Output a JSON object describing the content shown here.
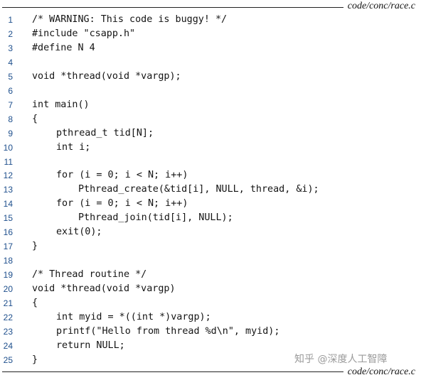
{
  "file": {
    "label_top": "code/conc/race.c",
    "label_bottom": "code/conc/race.c"
  },
  "code_lines": [
    {
      "n": "1",
      "indent": 0,
      "text": "/* WARNING: This code is buggy! */"
    },
    {
      "n": "2",
      "indent": 0,
      "text": "#include \"csapp.h\""
    },
    {
      "n": "3",
      "indent": 0,
      "text": "#define N 4"
    },
    {
      "n": "4",
      "indent": 0,
      "text": ""
    },
    {
      "n": "5",
      "indent": 0,
      "text": "void *thread(void *vargp);"
    },
    {
      "n": "6",
      "indent": 0,
      "text": ""
    },
    {
      "n": "7",
      "indent": 0,
      "text": "int main()"
    },
    {
      "n": "8",
      "indent": 0,
      "text": "{"
    },
    {
      "n": "9",
      "indent": 1,
      "text": "pthread_t tid[N];"
    },
    {
      "n": "10",
      "indent": 1,
      "text": "int i;"
    },
    {
      "n": "11",
      "indent": 0,
      "text": ""
    },
    {
      "n": "12",
      "indent": 1,
      "text": "for (i = 0; i < N; i++)"
    },
    {
      "n": "13",
      "indent": 2,
      "text": "Pthread_create(&tid[i], NULL, thread, &i);"
    },
    {
      "n": "14",
      "indent": 1,
      "text": "for (i = 0; i < N; i++)"
    },
    {
      "n": "15",
      "indent": 2,
      "text": "Pthread_join(tid[i], NULL);"
    },
    {
      "n": "16",
      "indent": 1,
      "text": "exit(0);"
    },
    {
      "n": "17",
      "indent": 0,
      "text": "}"
    },
    {
      "n": "18",
      "indent": 0,
      "text": ""
    },
    {
      "n": "19",
      "indent": 0,
      "text": "/* Thread routine */"
    },
    {
      "n": "20",
      "indent": 0,
      "text": "void *thread(void *vargp)"
    },
    {
      "n": "21",
      "indent": 0,
      "text": "{"
    },
    {
      "n": "22",
      "indent": 1,
      "text": "int myid = *((int *)vargp);"
    },
    {
      "n": "23",
      "indent": 1,
      "text": "printf(\"Hello from thread %d\\n\", myid);"
    },
    {
      "n": "24",
      "indent": 1,
      "text": "return NULL;"
    },
    {
      "n": "25",
      "indent": 0,
      "text": "}"
    }
  ],
  "watermark": "知乎 @深度人工智障"
}
